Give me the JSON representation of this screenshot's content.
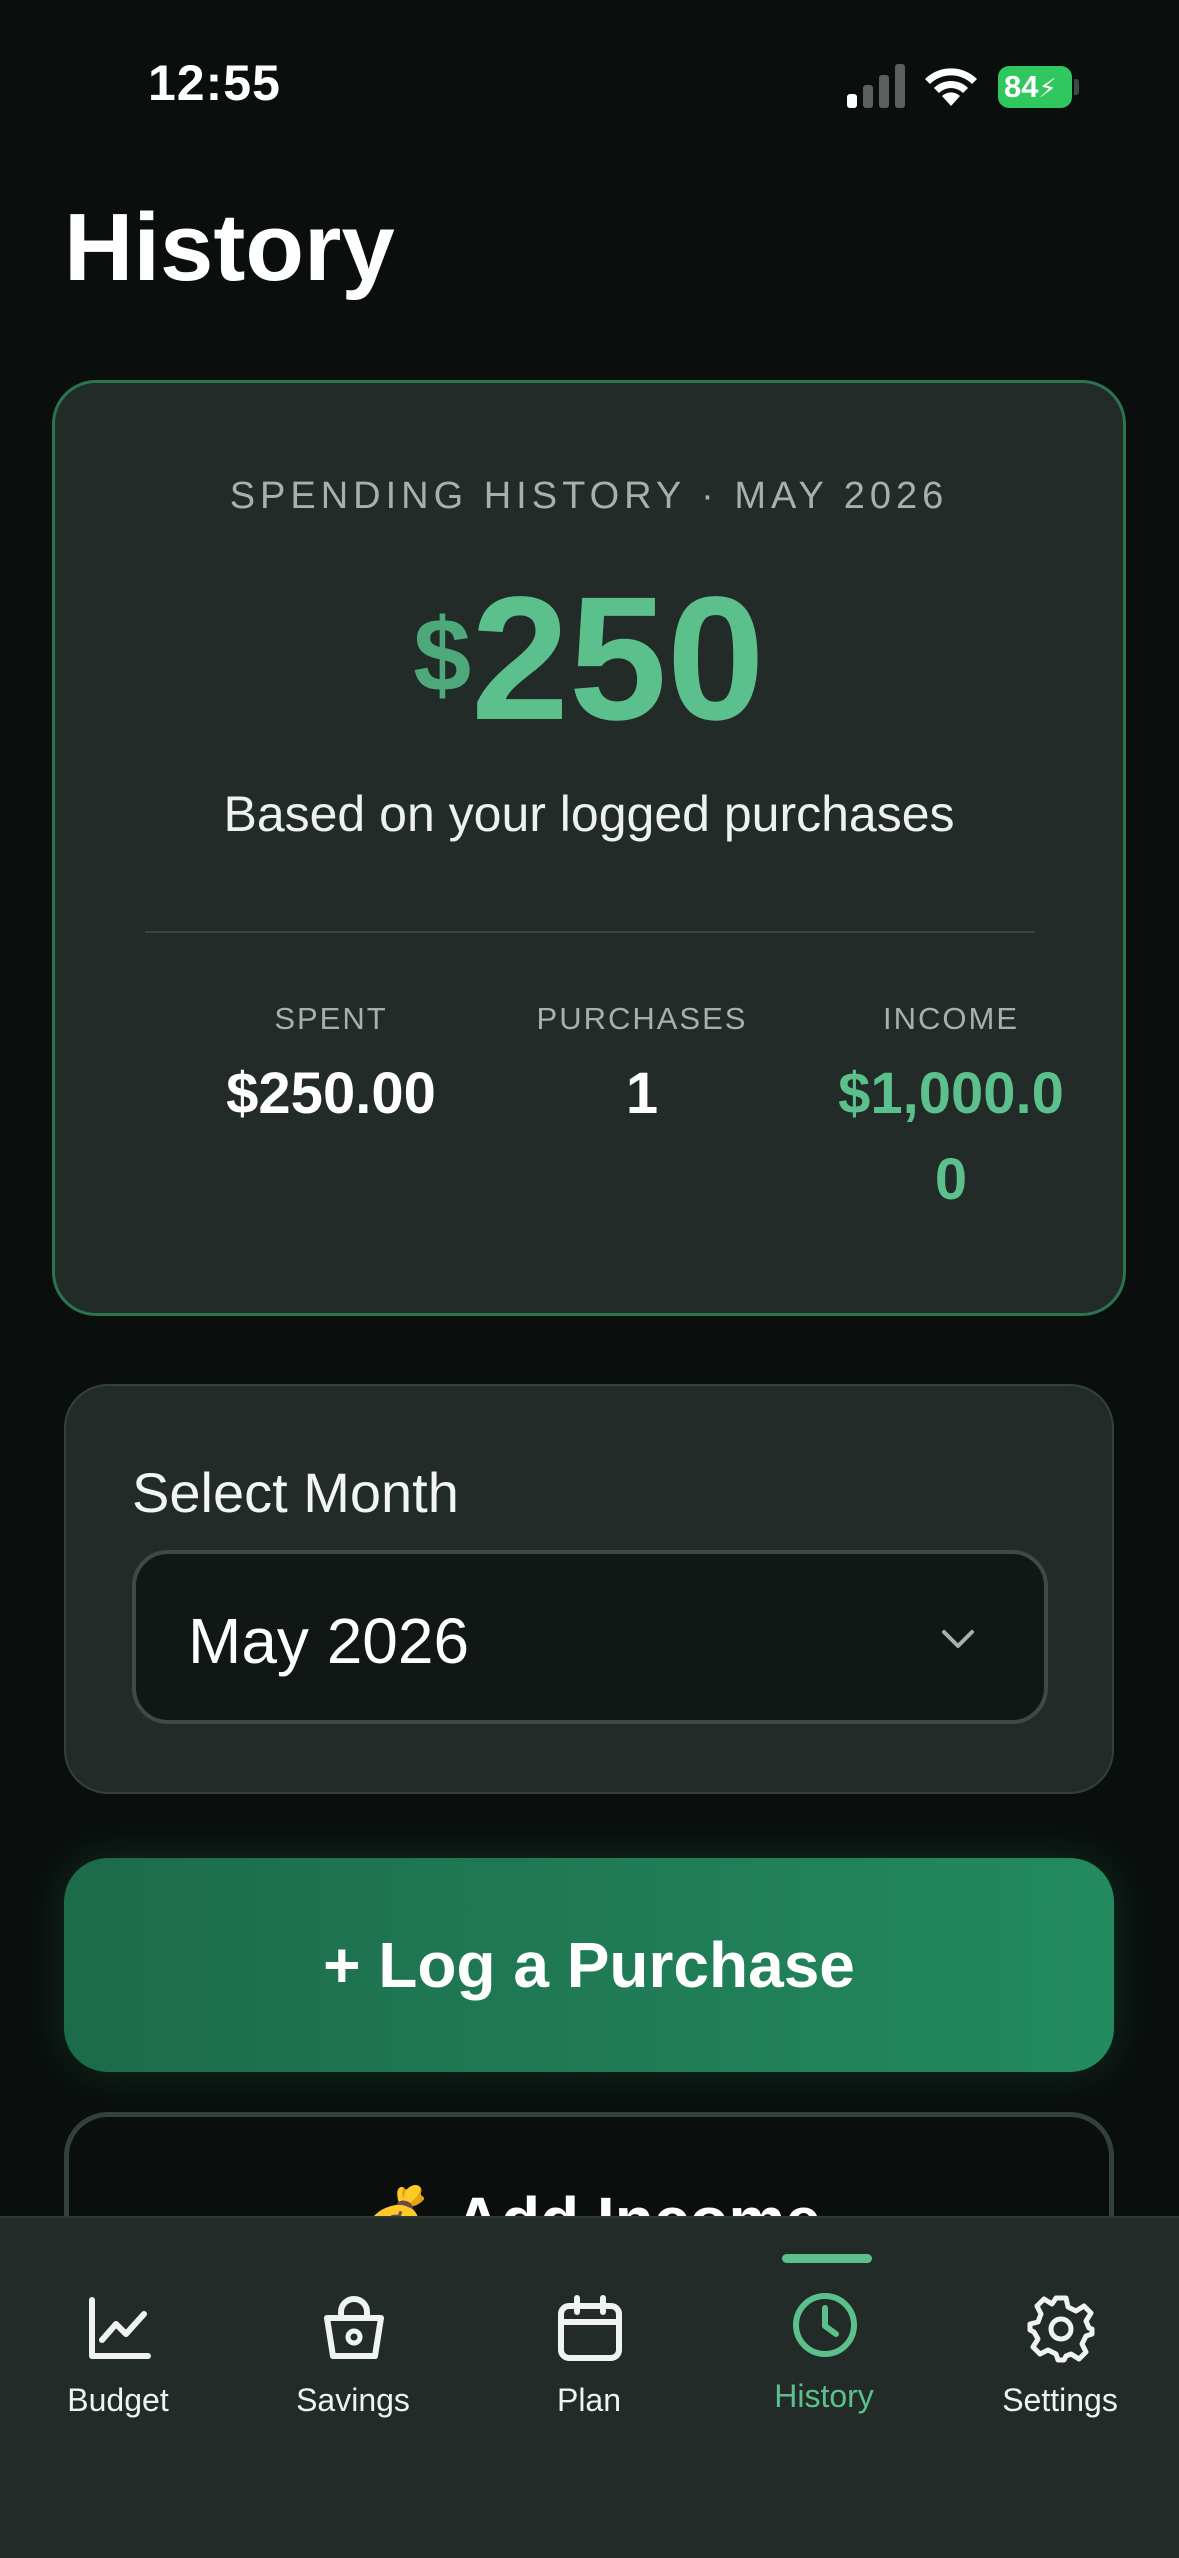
{
  "status_bar": {
    "time": "12:55",
    "battery": "84"
  },
  "page": {
    "title": "History"
  },
  "summary": {
    "eyebrow": "SPENDING HISTORY · MAY 2026",
    "currency": "$",
    "amount": "250",
    "caption": "Based on your logged purchases",
    "stats": {
      "spent_label": "SPENT",
      "spent_value": "$250.00",
      "purchases_label": "PURCHASES",
      "purchases_value": "1",
      "income_label": "INCOME",
      "income_value": "$1,000.00"
    }
  },
  "month_selector": {
    "label": "Select Month",
    "selected": "May 2026"
  },
  "actions": {
    "log_purchase": "+ Log a Purchase",
    "add_income": "Add Income",
    "add_income_icon": "💰"
  },
  "tabs": [
    {
      "label": "Budget",
      "icon": "chart-icon"
    },
    {
      "label": "Savings",
      "icon": "shopping-bag-icon"
    },
    {
      "label": "Plan",
      "icon": "calendar-icon"
    },
    {
      "label": "History",
      "icon": "clock-icon",
      "active": true
    },
    {
      "label": "Settings",
      "icon": "gear-icon"
    }
  ],
  "colors": {
    "accent": "#5cc08c",
    "card": "#222b27",
    "background": "#0a0f0d",
    "button": "#238a5f"
  }
}
